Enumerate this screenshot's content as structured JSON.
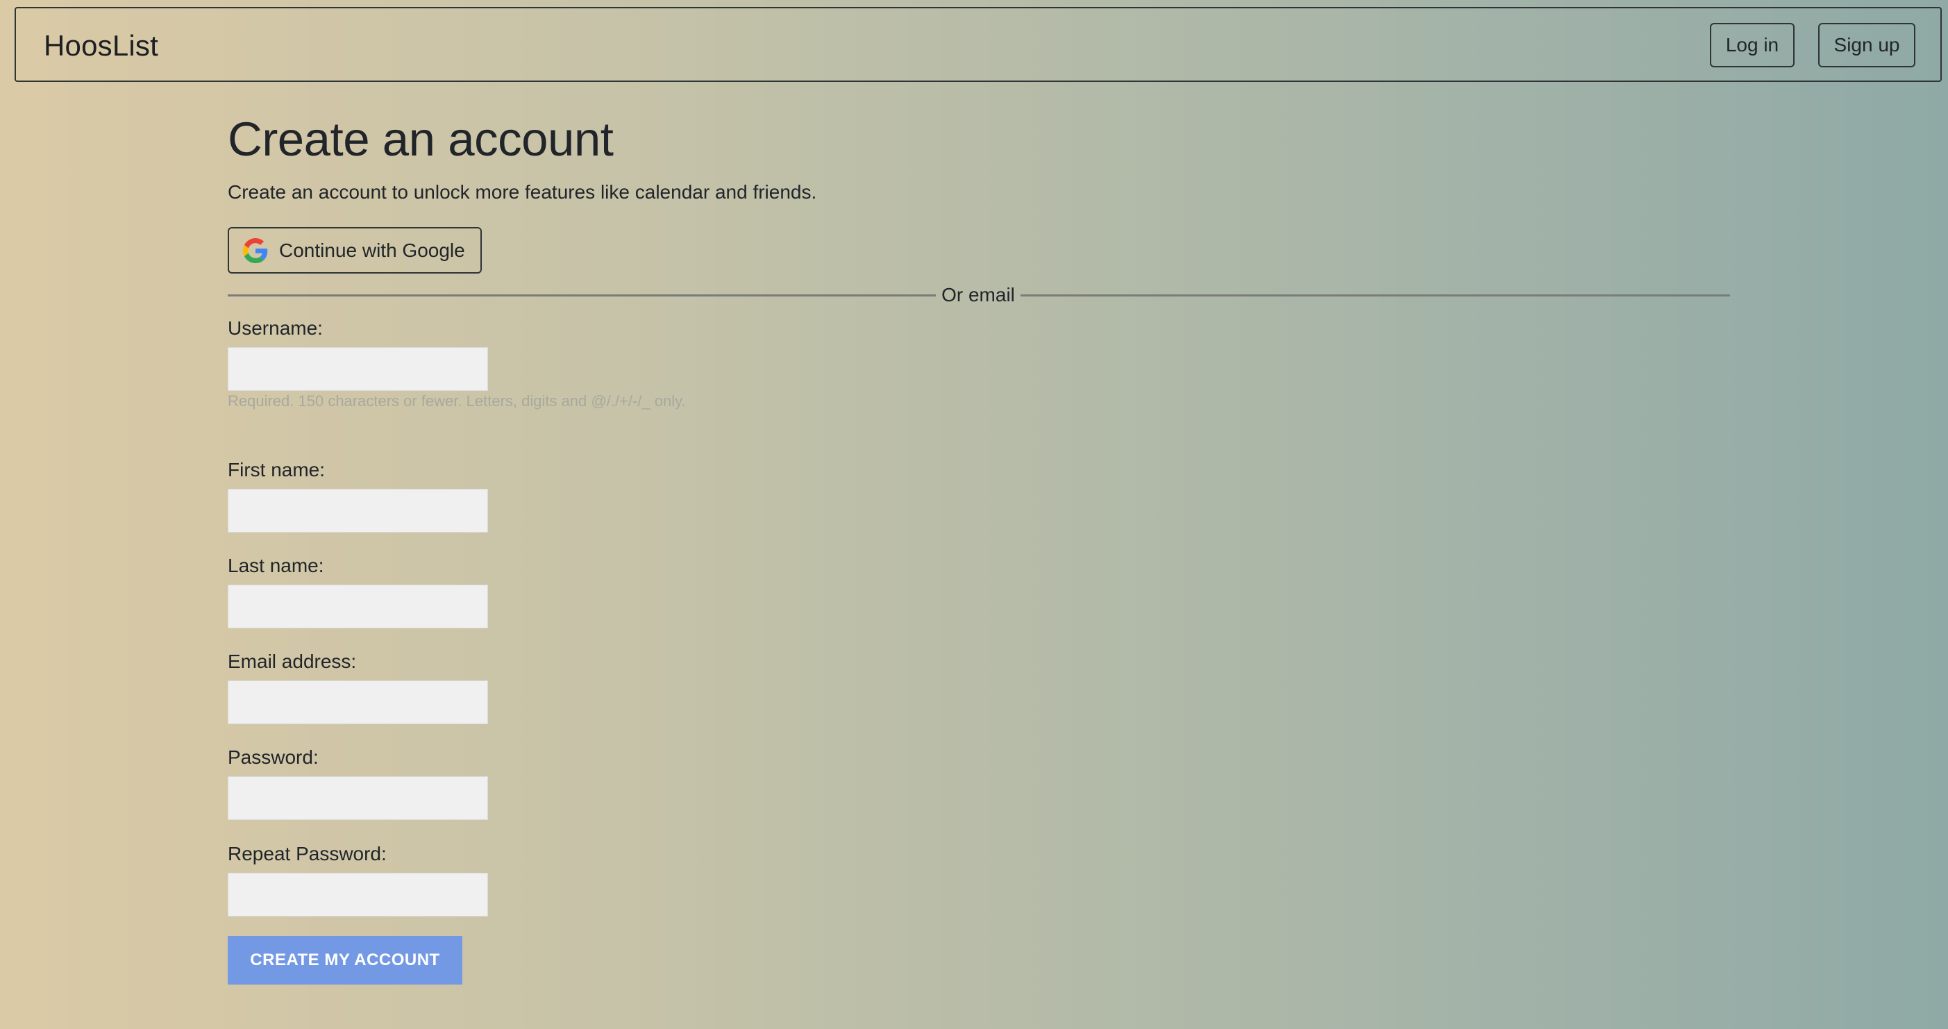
{
  "navbar": {
    "brand": "HoosList",
    "login_label": "Log in",
    "signup_label": "Sign up"
  },
  "page": {
    "title": "Create an account",
    "subtitle": "Create an account to unlock more features like calendar and friends.",
    "google_button_label": "Continue with Google",
    "google_icon": "google-g-icon",
    "divider_text": "Or email"
  },
  "form": {
    "username": {
      "label": "Username:",
      "value": "",
      "help_text": "Required. 150 characters or fewer. Letters, digits and @/./+/-/_ only."
    },
    "first_name": {
      "label": "First name:",
      "value": ""
    },
    "last_name": {
      "label": "Last name:",
      "value": ""
    },
    "email": {
      "label": "Email address:",
      "value": ""
    },
    "password": {
      "label": "Password:",
      "value": ""
    },
    "repeat_password": {
      "label": "Repeat Password:",
      "value": ""
    },
    "submit_label": "Create my account"
  },
  "colors": {
    "submit_button": "#7499e4",
    "input_background": "#f0f0f0",
    "gradient_start": "#dbcaa6",
    "gradient_end": "#8fa9a6"
  }
}
